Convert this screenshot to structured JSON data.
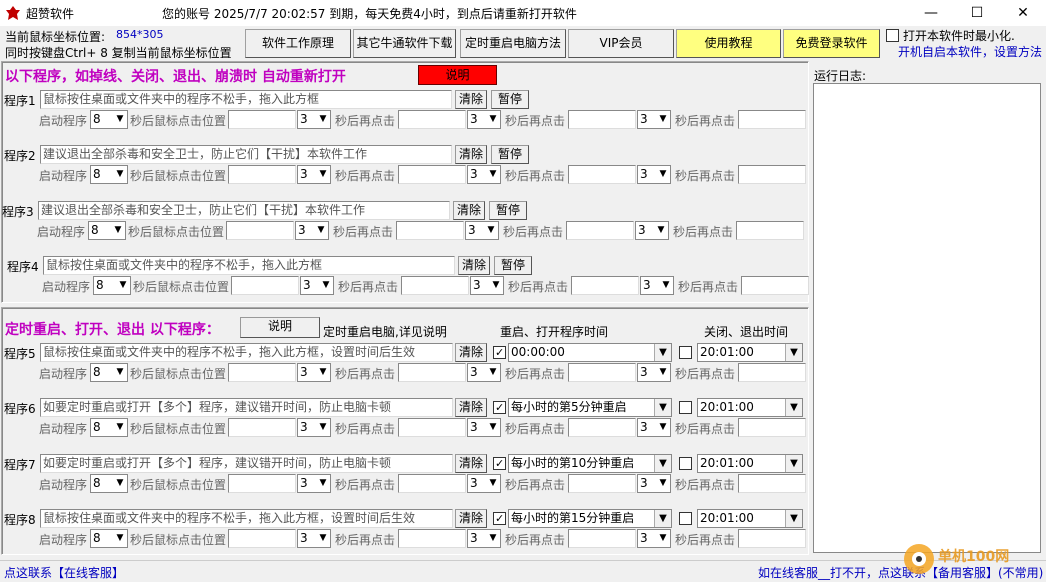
{
  "window": {
    "app_title": "超赞软件",
    "account_info": "您的账号 2025/7/7 20:02:57 到期，每天免费4小时，到点后请重新打开软件",
    "minimize": "—",
    "maximize": "☐",
    "close": "✕"
  },
  "coords": {
    "label": "当前鼠标坐标位置:",
    "value": "854*305",
    "hotkey_tip": "同时按键盘Ctrl+ 8 复制当前鼠标坐标位置"
  },
  "toolbar": {
    "buttons": [
      "软件工作原理",
      "其它牛通软件下载",
      "定时重启电脑方法",
      "VIP会员",
      "使用教程",
      "免费登录软件"
    ]
  },
  "options": {
    "minimize_on_open": "打开本软件时最小化.",
    "autostart_link": "开机自启本软件，设置方法"
  },
  "section1": {
    "title": "以下程序，如掉线、关闭、退出、崩溃时 自动重新打开",
    "explain_button": "说明",
    "programs": [
      {
        "label": "程序1",
        "placeholder": "鼠标按住桌面或文件夹中的程序不松手，拖入此方框"
      },
      {
        "label": "程序2",
        "placeholder": "建议退出全部杀毒和安全卫士，防止它们【干扰】本软件工作"
      },
      {
        "label": "程序3",
        "placeholder": "建议退出全部杀毒和安全卫士，防止它们【干扰】本软件工作"
      },
      {
        "label": "程序4",
        "placeholder": "鼠标按住桌面或文件夹中的程序不松手，拖入此方框"
      }
    ]
  },
  "section2": {
    "title": "定时重启、打开、退出 以下程序：",
    "explain_button": "说明",
    "reboot_note": "定时重启电脑,详见说明",
    "col_restart": "重启、打开程序时间",
    "col_close": "关闭、退出时间",
    "programs": [
      {
        "label": "程序5",
        "placeholder": "鼠标按住桌面或文件夹中的程序不松手，拖入此方框，设置时间后生效",
        "restart_checked": true,
        "restart_time": "00:00:00",
        "close_checked": false,
        "close_time": "20:01:00"
      },
      {
        "label": "程序6",
        "placeholder": "如要定时重启或打开【多个】程序，建议错开时间，防止电脑卡顿",
        "restart_checked": true,
        "restart_time": "每小时的第5分钟重启",
        "close_checked": false,
        "close_time": "20:01:00"
      },
      {
        "label": "程序7",
        "placeholder": "如要定时重启或打开【多个】程序，建议错开时间，防止电脑卡顿",
        "restart_checked": true,
        "restart_time": "每小时的第10分钟重启",
        "close_checked": false,
        "close_time": "20:01:00"
      },
      {
        "label": "程序8",
        "placeholder": "鼠标按住桌面或文件夹中的程序不松手，拖入此方框，设置时间后生效",
        "restart_checked": true,
        "restart_time": "每小时的第15分钟重启",
        "close_checked": false,
        "close_time": "20:01:00"
      }
    ]
  },
  "common": {
    "clear": "清除",
    "pause": "暂停",
    "start_label": "启动程序",
    "delay_value": "8",
    "click_label": "秒后鼠标点击位置",
    "again_label": "秒后再点击",
    "repeat_value": "3"
  },
  "log": {
    "label": "运行日志:"
  },
  "status": {
    "left_link": "点这联系【在线客服】",
    "right_link": "如在线客服__打不开，点这联系【备用客服】(不常用)"
  },
  "watermark_text": "单机100网"
}
